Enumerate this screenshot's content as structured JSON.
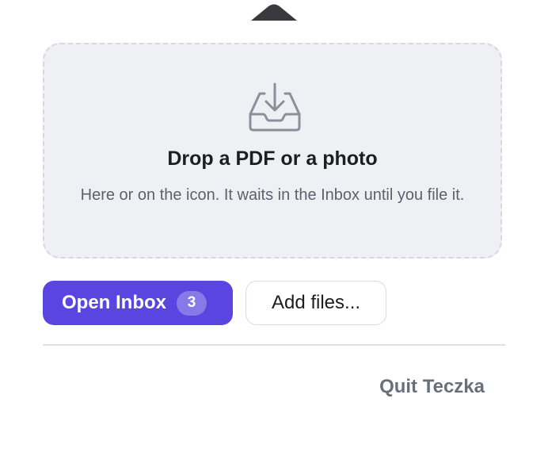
{
  "popover": {
    "dropzone": {
      "icon": "tray-download-icon",
      "title": "Drop a PDF or a photo",
      "subtitle": "Here or on the icon. It waits in the Inbox until you file it."
    },
    "actions": {
      "open_inbox_label": "Open Inbox",
      "inbox_count": "3",
      "add_files_label": "Add files..."
    },
    "footer": {
      "quit_label": "Quit Teczka"
    }
  },
  "colors": {
    "accent": "#5b45e0",
    "dropzone_bg": "#eff0f4",
    "dropzone_border": "#d5d8df",
    "text_primary": "#1d1d22",
    "text_secondary": "#5c6170",
    "quit_text": "#6a6f7c"
  }
}
